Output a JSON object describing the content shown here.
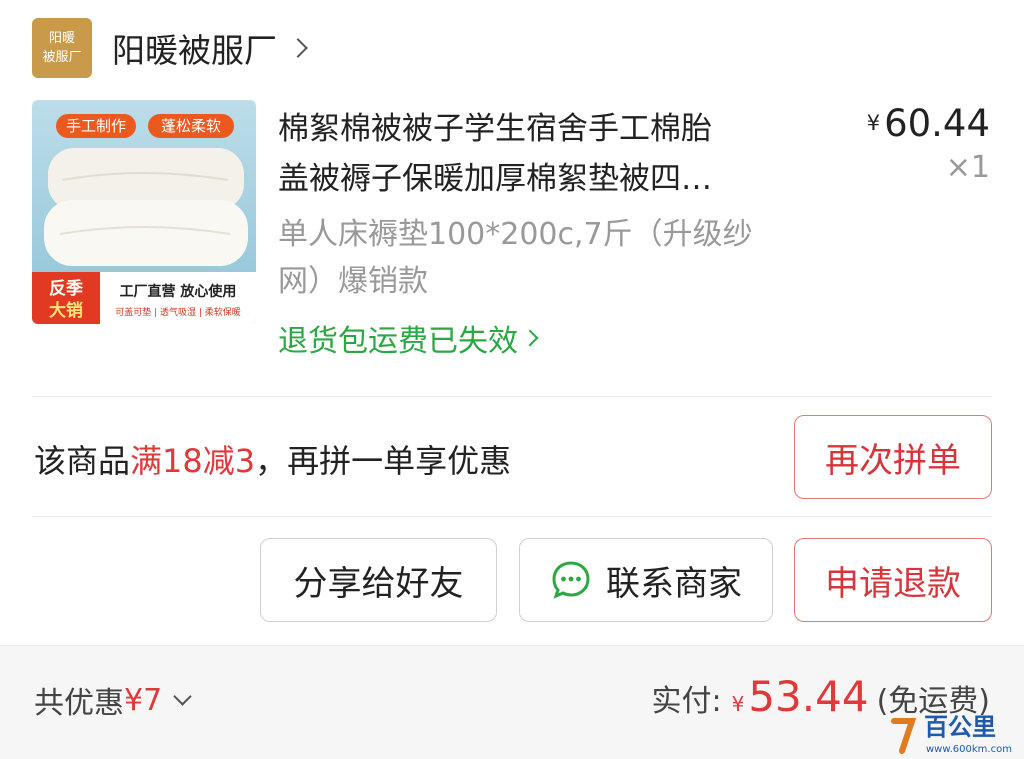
{
  "shop": {
    "logo_line1": "阳暖",
    "logo_line2": "被服厂",
    "name": "阳暖被服厂"
  },
  "product": {
    "thumbnail": {
      "badge_left": "手工制作",
      "badge_right": "蓬松柔软",
      "promo_tag_line1": "反季",
      "promo_tag_line2": "大销",
      "slogan": "工厂直营 放心使用",
      "features": "可盖可垫 | 透气吸湿 | 柔软保暖"
    },
    "title_line1": "棉絮棉被被子学生宿舍手工棉胎",
    "title_line2": "盖被褥子保暖加厚棉絮垫被四…",
    "price_currency": "¥",
    "price": "60.44",
    "quantity": "×1",
    "variant_line1": "单人床褥垫100*200c,7斤（升级纱",
    "variant_line2": "网）爆销款",
    "return_status": "退货包运费已失效"
  },
  "promo": {
    "prefix": "该商品",
    "highlight": "满18减3",
    "suffix": "，再拼一单享优惠",
    "button": "再次拼单"
  },
  "actions": {
    "share": "分享给好友",
    "contact": "联系商家",
    "refund": "申请退款"
  },
  "summary": {
    "discount_label": "共优惠",
    "discount_value": "¥7",
    "paid_label": "实付:",
    "paid_currency": "¥",
    "paid_amount": "53.44",
    "shipping_note": "(免运费)"
  },
  "watermark": {
    "brand": "百公里",
    "url": "www.600km.com"
  },
  "colors": {
    "accent_red": "#e0393a",
    "return_green": "#2ca743",
    "shop_logo_bg": "#c99a4a",
    "wechat_green": "#2ca743"
  }
}
